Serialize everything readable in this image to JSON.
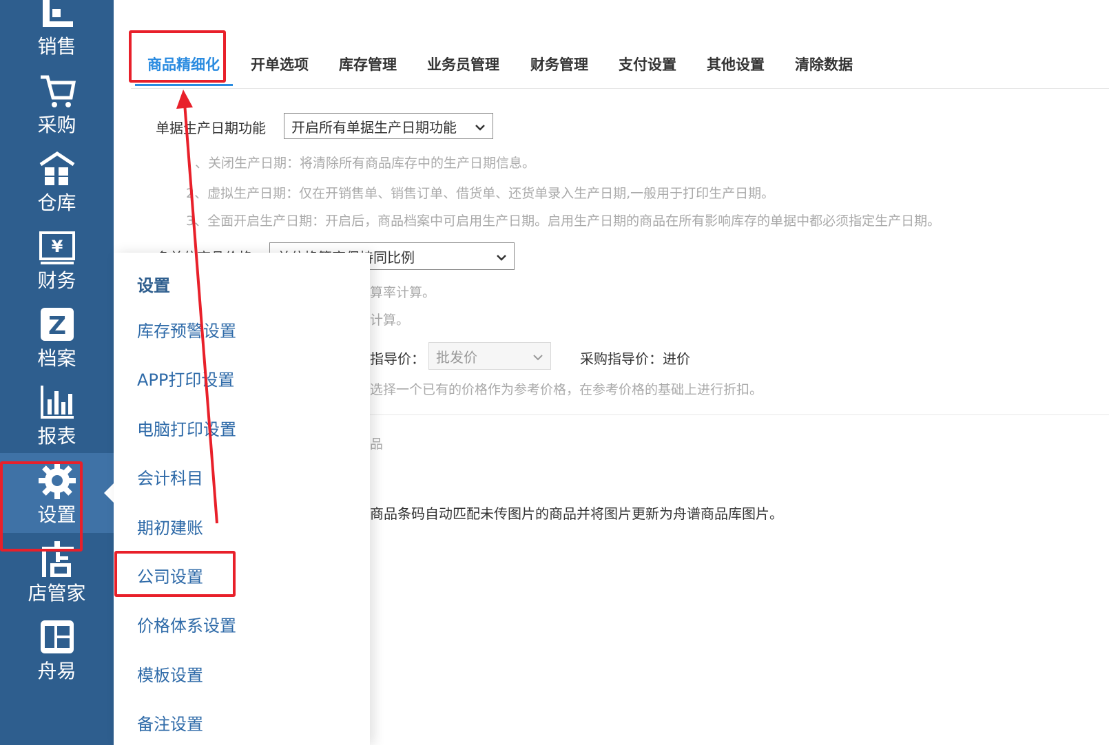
{
  "sidebar": {
    "items": [
      {
        "label": "销售",
        "icon": "sales-chart-icon"
      },
      {
        "label": "采购",
        "icon": "shopping-cart-icon"
      },
      {
        "label": "仓库",
        "icon": "warehouse-icon"
      },
      {
        "label": "财务",
        "icon": "yen-icon"
      },
      {
        "label": "档案",
        "icon": "archive-z-icon"
      },
      {
        "label": "报表",
        "icon": "bar-chart-icon"
      },
      {
        "label": "设置",
        "icon": "gear-icon"
      },
      {
        "label": "店管家",
        "icon": "store-icon"
      },
      {
        "label": "舟易",
        "icon": "zhouyi-logo-icon"
      }
    ],
    "active_index": 6
  },
  "tabs": [
    {
      "label": "商品精细化"
    },
    {
      "label": "开单选项"
    },
    {
      "label": "库存管理"
    },
    {
      "label": "业务员管理"
    },
    {
      "label": "财务管理"
    },
    {
      "label": "支付设置"
    },
    {
      "label": "其他设置"
    },
    {
      "label": "清除数据"
    }
  ],
  "content": {
    "production_date": {
      "label": "单据生产日期功能",
      "value": "开启所有单据生产日期功能",
      "notes": [
        "、关闭生产日期：将清除所有商品库存中的生产日期信息。",
        "2、虚拟生产日期：仅在开销售单、销售订单、借货单、还货单录入生产日期,一般用于打印生产日期。",
        "3、全面开启生产日期：开启后，商品档案中可启用生产日期。启用生产日期的商品在所有影响库存的单据中都必须指定生产日期。"
      ]
    },
    "multi_unit_price": {
      "label": "多单位商品价格",
      "value": "单位换算率保持同比例",
      "notes": [
        "算率计算。",
        "计算。"
      ]
    },
    "guide_price": {
      "sales_label": "指导价：",
      "sales_value": "批发价",
      "purchase_label": "采购指导价：进价",
      "note": "选择一个已有的价格作为参考价格，在参考价格的基础上进行折扣。"
    },
    "image_section": {
      "partial_label": "品",
      "note": "商品条码自动匹配未传图片的商品并将图片更新为舟谱商品库图片。"
    }
  },
  "menu": {
    "title": "设置",
    "items": [
      {
        "label": "库存预警设置"
      },
      {
        "label": "APP打印设置"
      },
      {
        "label": "电脑打印设置"
      },
      {
        "label": "会计科目"
      },
      {
        "label": "期初建账"
      },
      {
        "label": "公司设置"
      },
      {
        "label": "价格体系设置"
      },
      {
        "label": "模板设置"
      },
      {
        "label": "备注设置"
      }
    ]
  },
  "colors": {
    "sidebar_bg": "#2e5e8e",
    "active_tab": "#2a8be0",
    "menu_text": "#2e6aa8",
    "annotation_red": "#e8202a"
  }
}
